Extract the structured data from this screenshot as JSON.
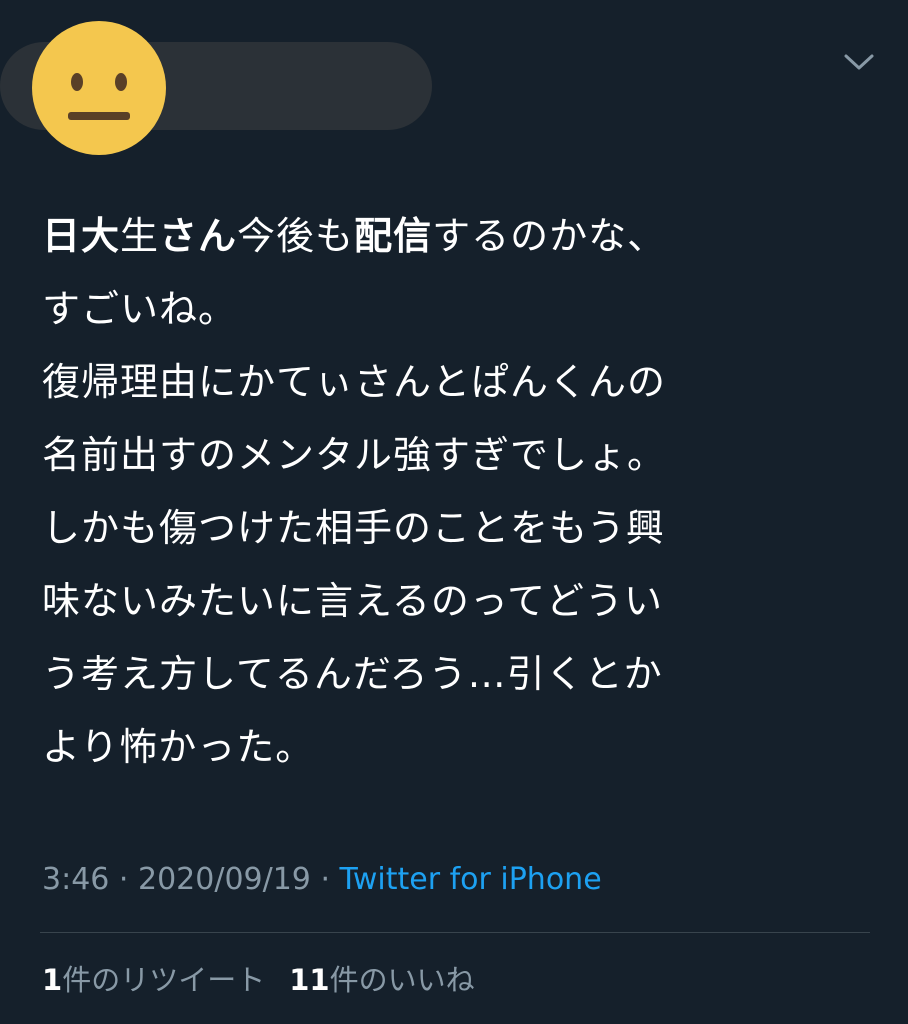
{
  "avatar": {
    "icon": "neutral-face-emoji",
    "color": "#f4c74e"
  },
  "header": {
    "menu_icon": "chevron-down-icon"
  },
  "tweet": {
    "segments": [
      {
        "text": "日大",
        "bold": true
      },
      {
        "text": "生",
        "bold": false
      },
      {
        "text": "さん",
        "bold": true
      },
      {
        "text": "今後も",
        "bold": false
      },
      {
        "text": "配信",
        "bold": true
      },
      {
        "text": "するのかな、\nすごいね。\n復帰理由にかてぃさんとぱんくんの\n名前出すのメンタル強すぎでしょ。\nしかも傷つけた相手のことをもう興\n味ないみたいに言えるのってどうい\nう考え方してるんだろう…引くとか\nより怖かった。",
        "bold": false
      }
    ]
  },
  "meta": {
    "time": "3:46",
    "separator": " · ",
    "date": "2020/09/19",
    "source": "Twitter for iPhone"
  },
  "stats": {
    "retweet_count": "1",
    "retweet_label": "件のリツイート",
    "like_count": "11",
    "like_label": "件のいいね"
  },
  "colors": {
    "background": "#15202b",
    "text": "#ffffff",
    "secondary": "#8899a6",
    "link": "#1da1f2",
    "divider": "#38444d",
    "name_pill": "#2b3137"
  }
}
